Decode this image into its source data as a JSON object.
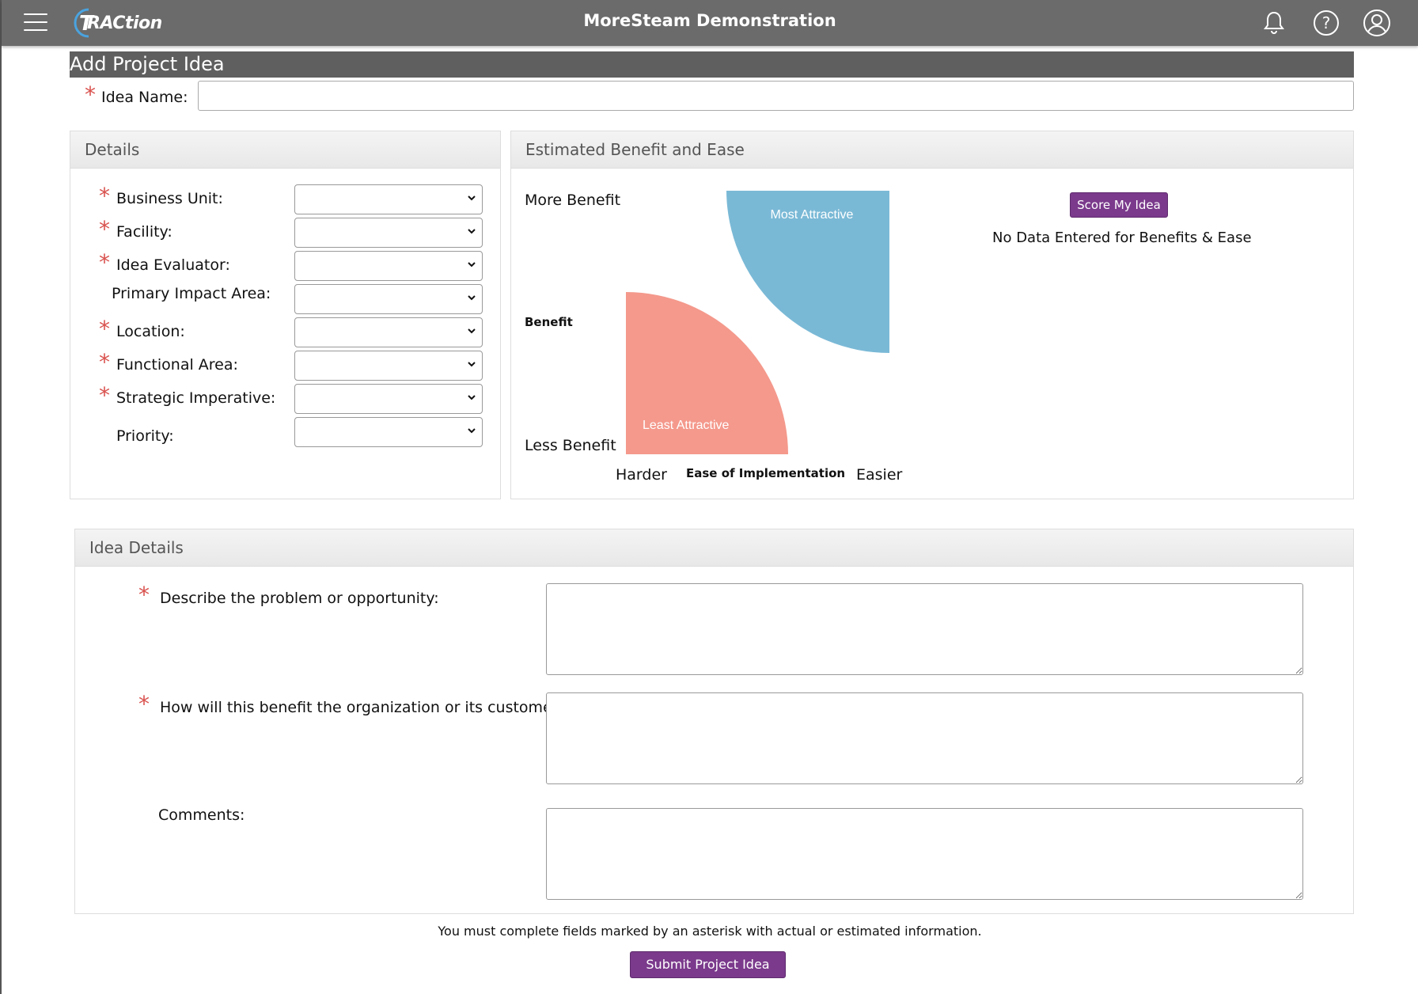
{
  "app": {
    "title": "MoreSteam Demonstration",
    "logo_text": "RACtion"
  },
  "page": {
    "title": "Add Project Idea"
  },
  "idea_name": {
    "label": "Idea Name:",
    "value": ""
  },
  "details": {
    "heading": "Details",
    "fields": [
      {
        "label": "Business Unit:",
        "required": true,
        "value": ""
      },
      {
        "label": "Facility:",
        "required": true,
        "value": ""
      },
      {
        "label": "Idea Evaluator:",
        "required": true,
        "value": ""
      },
      {
        "label": "Primary Impact Area:",
        "required": false,
        "value": ""
      },
      {
        "label": "Location:",
        "required": true,
        "value": ""
      },
      {
        "label": "Functional Area:",
        "required": true,
        "value": ""
      },
      {
        "label": "Strategic Imperative:",
        "required": true,
        "value": ""
      },
      {
        "label": "Priority:",
        "required": false,
        "value": ""
      }
    ]
  },
  "benefit_ease": {
    "heading": "Estimated Benefit and Ease",
    "more_benefit": "More Benefit",
    "benefit": "Benefit",
    "less_benefit": "Less Benefit",
    "harder": "Harder",
    "ease": "Ease of Implementation",
    "easier": "Easier",
    "most_attractive": "Most Attractive",
    "least_attractive": "Least Attractive",
    "score_button": "Score My Idea",
    "status": "No Data Entered for Benefits & Ease",
    "colors": {
      "most": "#7ab9d6",
      "least": "#f4998c"
    }
  },
  "idea_details": {
    "heading": "Idea Details",
    "problem_label": "Describe the problem or opportunity:",
    "benefit_label": "How will this benefit the organization or its customers:",
    "comments_label": "Comments:"
  },
  "footer": {
    "note": "You must complete fields marked by an asterisk with actual or estimated information.",
    "submit": "Submit Project Idea"
  },
  "colors": {
    "accent": "#7b3a8c",
    "topbar": "#6b6b6b",
    "required": "#d9534f"
  }
}
